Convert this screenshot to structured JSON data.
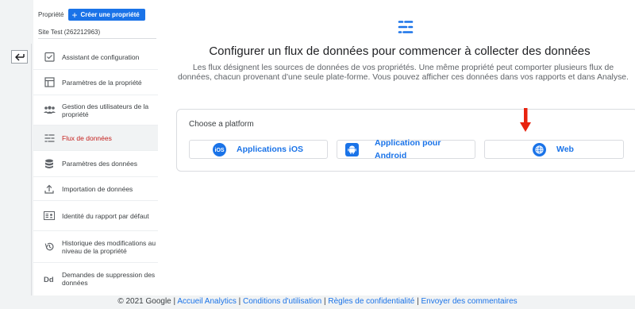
{
  "sidebar": {
    "property_label": "Propriété",
    "create_button": "Créer une propriété",
    "site_name": "Site Test (262212963)",
    "items": [
      {
        "label": "Assistant de configuration",
        "icon": "checklist-icon"
      },
      {
        "label": "Paramètres de la propriété",
        "icon": "property-settings-icon"
      },
      {
        "label": "Gestion des utilisateurs de la propriété",
        "icon": "users-icon"
      },
      {
        "label": "Flux de données",
        "icon": "data-streams-icon",
        "active": true
      },
      {
        "label": "Paramètres des données",
        "icon": "database-icon"
      },
      {
        "label": "Importation de données",
        "icon": "upload-icon"
      },
      {
        "label": "Identité du rapport par défaut",
        "icon": "report-identity-icon"
      },
      {
        "label": "Historique des modifications au niveau de la propriété",
        "icon": "history-icon"
      },
      {
        "label": "Demandes de suppression des données",
        "icon": "data-deletion-icon"
      }
    ]
  },
  "main": {
    "title": "Configurer un flux de données pour commencer à collecter des données",
    "description": "Les flux désignent les sources de données de vos propriétés. Une même propriété peut comporter plusieurs flux de données, chacun provenant d'une seule plate-forme. Vous pouvez afficher ces données dans vos rapports et dans Analyse.",
    "card_title": "Choose a platform",
    "platforms": [
      {
        "label": "Applications iOS",
        "icon": "ios-icon"
      },
      {
        "label": "Application pour Android",
        "icon": "android-icon"
      },
      {
        "label": "Web",
        "icon": "globe-icon"
      }
    ]
  },
  "footer": {
    "copyright": "© 2021 Google |",
    "links": [
      "Accueil Analytics",
      "Conditions d'utilisation",
      "Règles de confidentialité",
      "Envoyer des commentaires"
    ],
    "separator": "|"
  },
  "colors": {
    "accent": "#1a73e8",
    "active": "#c5221f",
    "annotation_arrow": "#e8230f"
  }
}
